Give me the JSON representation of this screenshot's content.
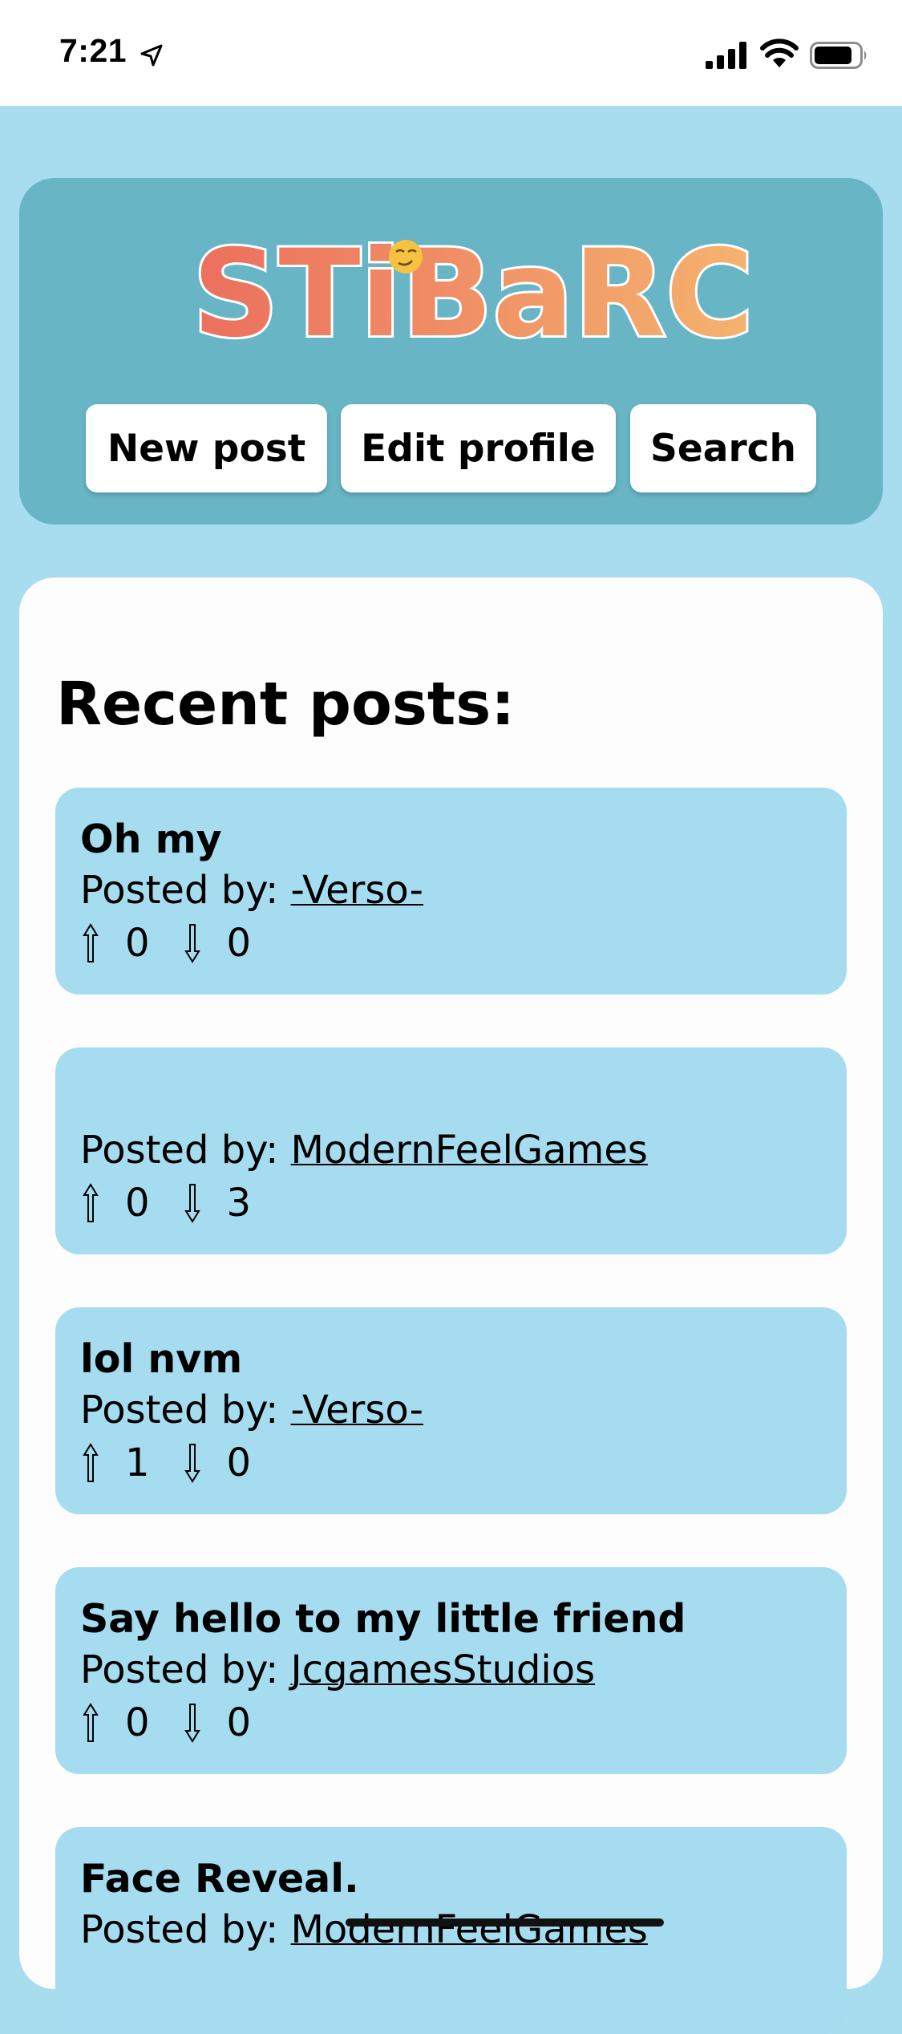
{
  "status_bar": {
    "time": "7:21"
  },
  "header": {
    "logo_text": "STiBaRC",
    "buttons": {
      "new_post": "New post",
      "edit_profile": "Edit profile",
      "search": "Search"
    }
  },
  "main": {
    "title": "Recent posts:",
    "posted_by_label": "Posted by:",
    "posts": [
      {
        "title": "Oh my",
        "author": "-Verso-",
        "upvotes": "0",
        "downvotes": "0"
      },
      {
        "title": "",
        "author": "ModernFeelGames",
        "upvotes": "0",
        "downvotes": "3"
      },
      {
        "title": "lol nvm",
        "author": "-Verso-",
        "upvotes": "1",
        "downvotes": "0"
      },
      {
        "title": "Say hello to my little friend",
        "author": "JcgamesStudios",
        "upvotes": "0",
        "downvotes": "0"
      },
      {
        "title": "Face Reveal.",
        "author": "ModernFeelGames",
        "upvotes": "",
        "downvotes": ""
      }
    ]
  },
  "colors": {
    "background": "#a8dcef",
    "header_card": "#68b5c6",
    "post_card": "#a6dcef",
    "logo_gradient_start": "#ec6f5e",
    "logo_gradient_end": "#f5b36e"
  }
}
